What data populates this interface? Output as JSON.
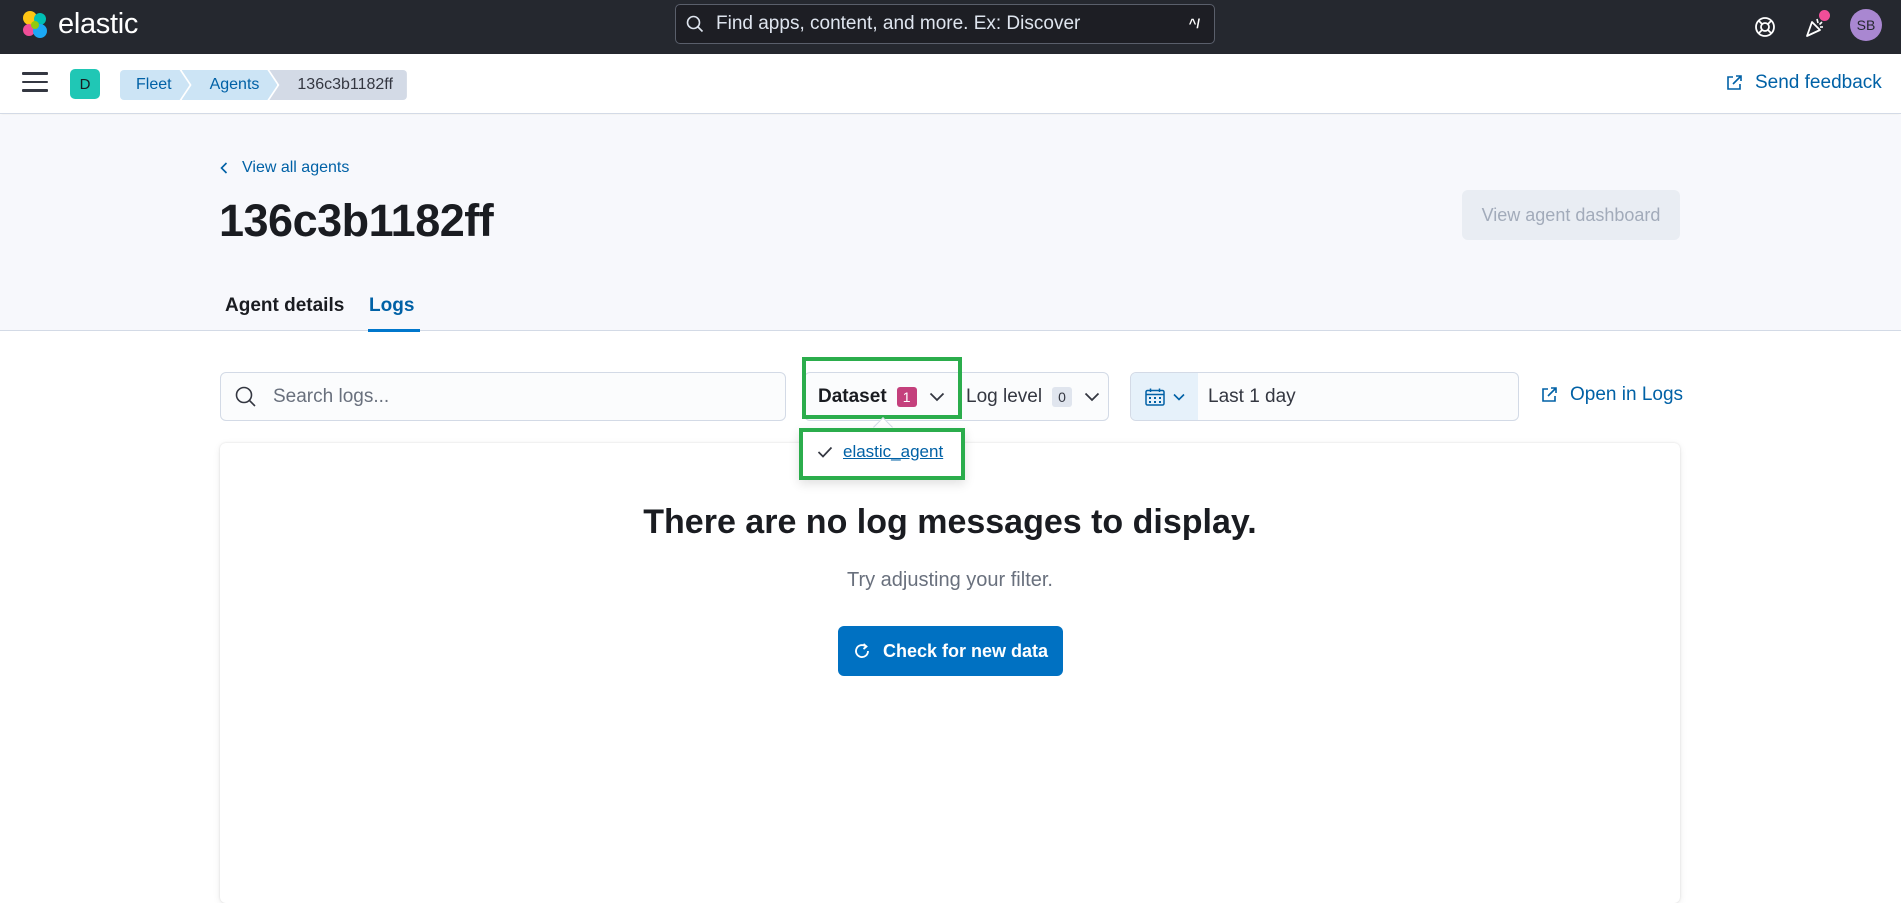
{
  "header": {
    "logo_text": "elastic",
    "search_placeholder": "Find apps, content, and more. Ex: Discover",
    "search_shortcut": "^/",
    "user_initials": "SB"
  },
  "subnav": {
    "space_initial": "D",
    "breadcrumbs": [
      "Fleet",
      "Agents",
      "136c3b1182ff"
    ],
    "send_feedback": "Send feedback"
  },
  "page": {
    "back_link": "View all agents",
    "title": "136c3b1182ff",
    "dashboard_button": "View agent dashboard",
    "tabs": [
      {
        "label": "Agent details",
        "active": false
      },
      {
        "label": "Logs",
        "active": true
      }
    ]
  },
  "filters": {
    "search_placeholder": "Search logs...",
    "dataset_label": "Dataset",
    "dataset_count": "1",
    "log_level_label": "Log level",
    "log_level_count": "0",
    "date_range": "Last 1 day",
    "open_in_logs": "Open in Logs"
  },
  "dataset_popover": {
    "options": [
      {
        "label": "elastic_agent",
        "checked": true
      }
    ]
  },
  "empty_state": {
    "title": "There are no log messages to display.",
    "subtitle": "Try adjusting your filter.",
    "button": "Check for new data"
  },
  "colors": {
    "header_bg": "#25282f",
    "link": "#0061a6",
    "primary_button": "#0071c2",
    "highlight": "#2bad4c",
    "dataset_badge": "#c4407c"
  }
}
